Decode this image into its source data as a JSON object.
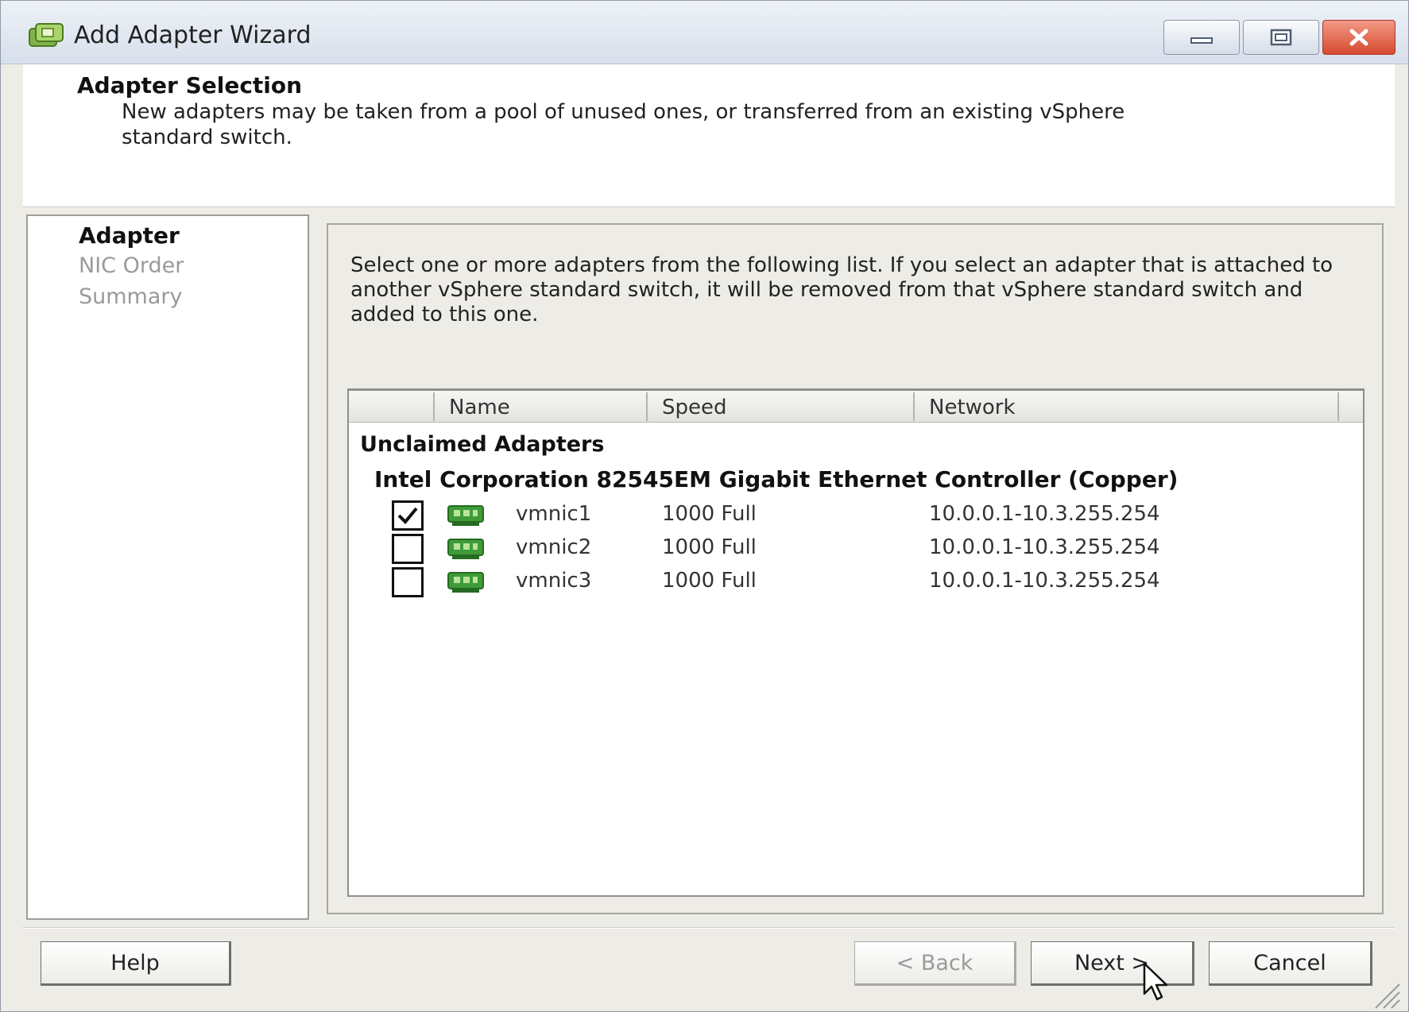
{
  "window": {
    "title": "Add Adapter Wizard",
    "icon": "wizard-app-icon",
    "controls": [
      "minimize-icon",
      "maximize-icon",
      "close-icon"
    ]
  },
  "header": {
    "title": "Adapter Selection",
    "description": "New adapters may be taken from a pool of unused ones, or transferred from an existing vSphere standard switch."
  },
  "steps": [
    {
      "label": "Adapter",
      "active": true
    },
    {
      "label": "NIC Order",
      "active": false
    },
    {
      "label": "Summary",
      "active": false
    }
  ],
  "main": {
    "instructions": "Select one or more adapters from the following list. If you select an adapter that is attached to another vSphere standard switch, it will be removed from that vSphere standard switch and added to this one.",
    "columns": [
      "Name",
      "Speed",
      "Network"
    ],
    "group_label": "Unclaimed Adapters",
    "controller_label": "Intel Corporation 82545EM Gigabit Ethernet Controller (Copper)",
    "adapters": [
      {
        "name": "vmnic1",
        "speed": "1000 Full",
        "network": "10.0.0.1-10.3.255.254",
        "checked": true
      },
      {
        "name": "vmnic2",
        "speed": "1000 Full",
        "network": "10.0.0.1-10.3.255.254",
        "checked": false
      },
      {
        "name": "vmnic3",
        "speed": "1000 Full",
        "network": "10.0.0.1-10.3.255.254",
        "checked": false
      }
    ]
  },
  "footer": {
    "help_label": "Help",
    "back_label": "< Back",
    "next_label": "Next >",
    "cancel_label": "Cancel"
  },
  "colors": {
    "window_bg": "#eeece6",
    "titlebar": "#d7dfeb",
    "close_button": "#d54a2f",
    "nic_icon": "#3f9b3a",
    "disabled_text": "#9a9a9a"
  }
}
